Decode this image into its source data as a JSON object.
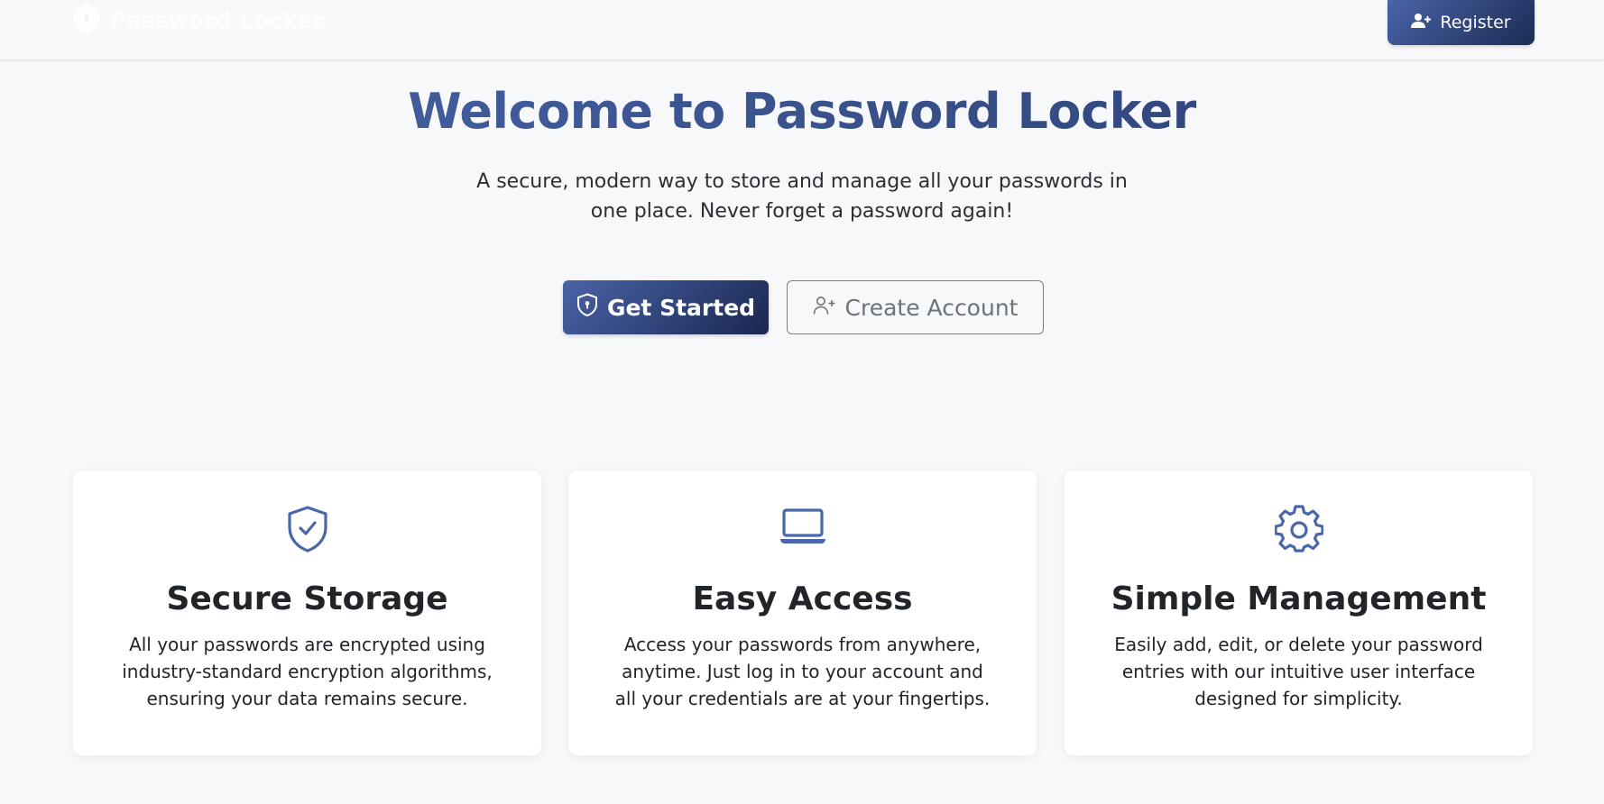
{
  "navbar": {
    "brand_name": "Password Locker",
    "brand_icon": "shield-icon",
    "register_label": "Register",
    "register_icon": "user-plus-icon"
  },
  "hero": {
    "title": "Welcome to Password Locker",
    "subtitle": "A secure, modern way to store and manage all your passwords in one place. Never forget a password again!",
    "primary_button": {
      "label": "Get Started",
      "icon": "shield-lock-icon"
    },
    "secondary_button": {
      "label": "Create Account",
      "icon": "user-plus-icon"
    }
  },
  "features": [
    {
      "icon": "shield-check-icon",
      "title": "Secure Storage",
      "text": "All your passwords are encrypted using industry-standard encryption algorithms, ensuring your data remains secure."
    },
    {
      "icon": "laptop-icon",
      "title": "Easy Access",
      "text": "Access your passwords from anywhere, anytime. Just log in to your account and all your credentials are at your fingertips."
    },
    {
      "icon": "gear-icon",
      "title": "Simple Management",
      "text": "Easily add, edit, or delete your password entries with our intuitive user interface designed for simplicity."
    }
  ],
  "colors": {
    "accent": "#4a67aa",
    "accent_dark": "#1c2b55",
    "background": "#f7f8fa",
    "card_bg": "#ffffff",
    "outline_text": "#6c737a"
  }
}
